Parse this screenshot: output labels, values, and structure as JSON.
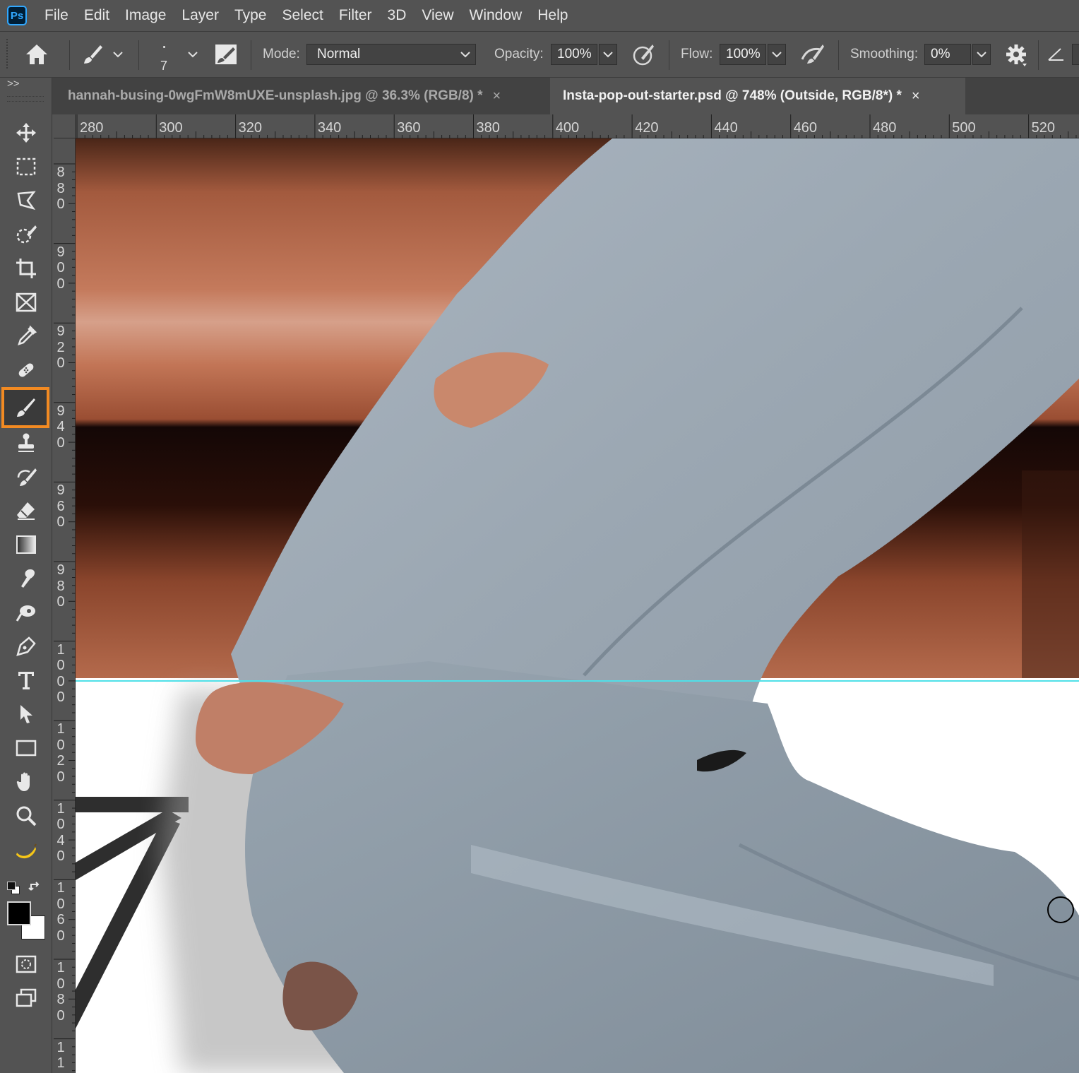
{
  "app": {
    "logo_text": "Ps"
  },
  "menu": [
    "File",
    "Edit",
    "Image",
    "Layer",
    "Type",
    "Select",
    "Filter",
    "3D",
    "View",
    "Window",
    "Help"
  ],
  "options": {
    "brush_size": "7",
    "mode_label": "Mode:",
    "mode_value": "Normal",
    "opacity_label": "Opacity:",
    "opacity_value": "100%",
    "flow_label": "Flow:",
    "flow_value": "100%",
    "smoothing_label": "Smoothing:",
    "smoothing_value": "0%"
  },
  "tabs": [
    {
      "title": "hannah-busing-0wgFmW8mUXE-unsplash.jpg @ 36.3% (RGB/8) *",
      "close": "×"
    },
    {
      "title": "Insta-pop-out-starter.psd @ 748% (Outside, RGB/8*) *",
      "close": "×"
    }
  ],
  "panel_toggle": ">>",
  "ruler_h": [
    "280",
    "300",
    "320",
    "340",
    "360",
    "380",
    "400",
    "420",
    "440",
    "460",
    "480",
    "500",
    "520"
  ],
  "ruler_v": [
    [
      "8",
      "8",
      "0"
    ],
    [
      "9",
      "0",
      "0"
    ],
    [
      "9",
      "2",
      "0"
    ],
    [
      "9",
      "4",
      "0"
    ],
    [
      "9",
      "6",
      "0"
    ],
    [
      "9",
      "8",
      "0"
    ],
    [
      "1",
      "0",
      "0",
      "0"
    ],
    [
      "1",
      "0",
      "2",
      "0"
    ],
    [
      "1",
      "0",
      "4",
      "0"
    ],
    [
      "1",
      "0",
      "6",
      "0"
    ],
    [
      "1",
      "0",
      "8",
      "0"
    ],
    [
      "1",
      "1"
    ]
  ],
  "colors": {
    "foreground": "#000000",
    "background": "#ffffff",
    "active_tool_highlight": "#f28a22",
    "guide": "#4fe0e8"
  }
}
